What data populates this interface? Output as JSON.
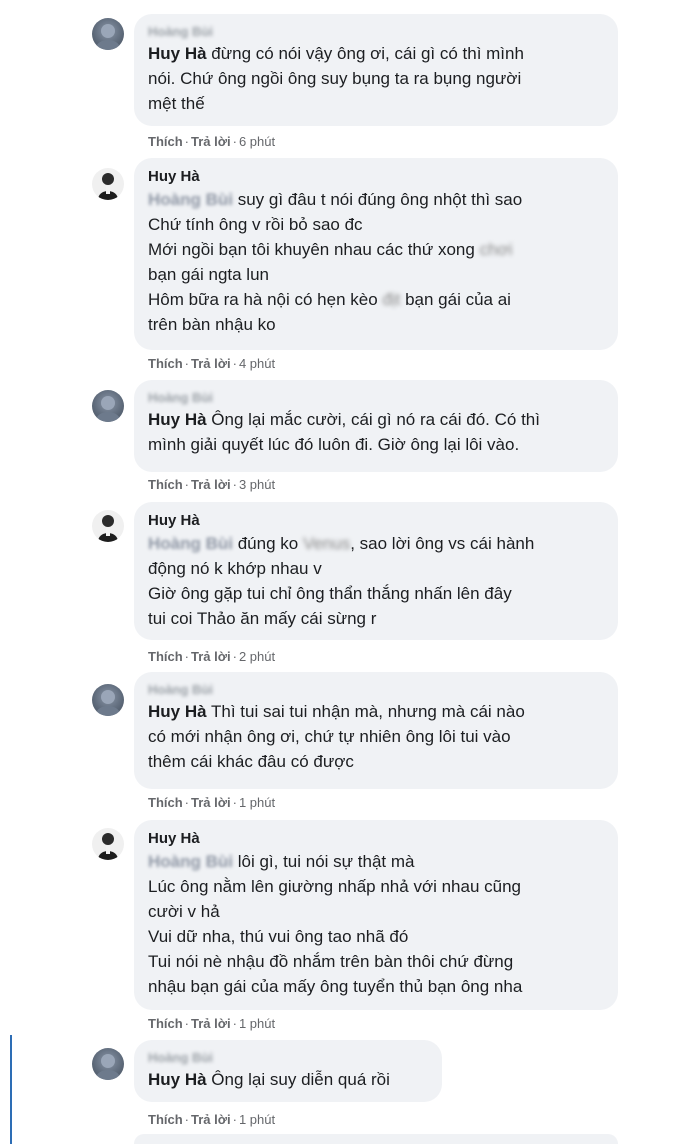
{
  "actions": {
    "like": "Thích",
    "reply": "Trả lời",
    "separator": "·"
  },
  "comments": [
    {
      "author": "Hoàng Bùi",
      "author_blurred": true,
      "lines": [
        {
          "mention": "Huy Hà",
          "text": " đừng có nói vậy ông ơi, cái gì có thì mình"
        },
        {
          "text": "nói. Chứ ông ngồi ông suy bụng ta ra bụng người"
        },
        {
          "text": "mệt thế"
        }
      ],
      "time": "6 phút"
    },
    {
      "author": "Huy Hà",
      "author_blurred": false,
      "lines": [
        {
          "mention": "Hoàng Bùi",
          "mention_blurred": true,
          "text": " suy gì đâu t nói đúng ông nhột thì sao"
        },
        {
          "text": "Chứ tính ông v rồi bỏ sao đc"
        },
        {
          "text": "Mới ngồi bạn tôi khuyên nhau các thứ xong ",
          "blur": "chơi"
        },
        {
          "text": "bạn gái ngta lun"
        },
        {
          "text": "Hôm bữa ra hà nội có hẹn kèo ",
          "blur": "địt",
          "after": " bạn gái của ai"
        },
        {
          "text": "trên bàn nhậu ko"
        }
      ],
      "time": "4 phút"
    },
    {
      "author": "Hoàng Bùi",
      "author_blurred": true,
      "lines": [
        {
          "mention": "Huy Hà",
          "text": " Ông lại mắc cười, cái gì nó ra cái đó. Có thì"
        },
        {
          "text": "mình giải quyết lúc đó luôn đi. Giờ ông lại lôi vào."
        }
      ],
      "time": "3 phút"
    },
    {
      "author": "Huy Hà",
      "author_blurred": false,
      "lines": [
        {
          "mention": "Hoàng Bùi",
          "mention_blurred": true,
          "text": " đúng ko ",
          "blur": "Venus",
          "after": ", sao lời ông vs cái hành"
        },
        {
          "text": "động nó k khớp nhau v"
        },
        {
          "text": "Giờ ông gặp tui chỉ ông thẩn thắng nhấn lên đây"
        },
        {
          "text": "tui coi Thảo ăn mấy cái sừng r"
        }
      ],
      "time": "2 phút"
    },
    {
      "author": "Hoàng Bùi",
      "author_blurred": true,
      "lines": [
        {
          "mention": "Huy Hà",
          "text": " Thì tui sai tui nhận mà, nhưng mà cái nào"
        },
        {
          "text": "có mới nhận ông ơi, chứ tự nhiên ông lôi tui vào"
        },
        {
          "text": "thêm cái khác đâu có được"
        }
      ],
      "time": "1 phút"
    },
    {
      "author": "Huy Hà",
      "author_blurred": false,
      "lines": [
        {
          "mention": "Hoàng Bùi",
          "mention_blurred": true,
          "text": " lôi gì, tui nói sự thật mà"
        },
        {
          "text": "Lúc ông nằm lên giường nhấp nhả với nhau cũng"
        },
        {
          "text": "cười v hả"
        },
        {
          "text": "Vui dữ nha, thú vui ông tao nhã đó"
        },
        {
          "text": "Tui nói nè nhậu đồ nhắm trên bàn thôi chứ đừng"
        },
        {
          "text": "nhậu bạn gái của mấy ông tuyển thủ bạn ông nha"
        }
      ],
      "time": "1 phút"
    },
    {
      "author": "Hoàng Bùi",
      "author_blurred": true,
      "lines": [
        {
          "mention": "Huy Hà",
          "text": " Ông lại suy diễn quá rồi"
        }
      ],
      "time": "1 phút"
    }
  ]
}
